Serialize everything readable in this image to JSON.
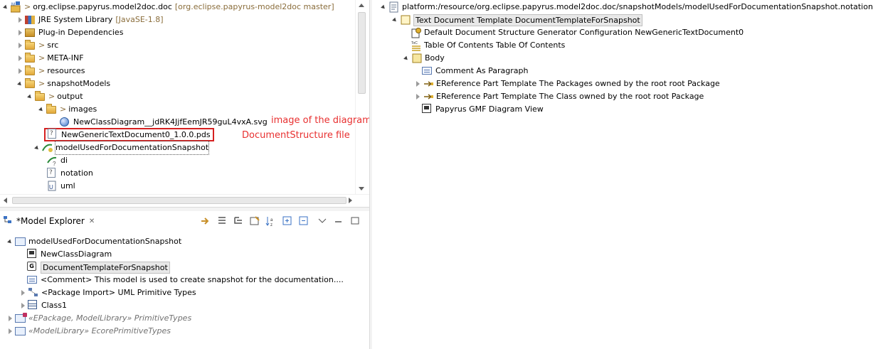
{
  "project_tree": {
    "root": {
      "label": "org.eclipse.papyrus.model2doc.doc",
      "suffix": "[org.eclipse.papyrus-model2doc master]"
    },
    "items": [
      {
        "label": "JRE System Library",
        "suffix": "[JavaSE-1.8]"
      },
      {
        "label": "Plug-in Dependencies"
      },
      {
        "label": "src"
      },
      {
        "label": "META-INF"
      },
      {
        "label": "resources"
      },
      {
        "label": "snapshotModels"
      },
      {
        "label": "output"
      },
      {
        "label": "images"
      },
      {
        "label": "NewClassDiagram__jdRK4JjfEemJR59guL4vxA.svg"
      },
      {
        "label": "NewGenericTextDocument0_1.0.0.pds"
      },
      {
        "label": "modelUsedForDocumentationSnapshot"
      },
      {
        "label": "di"
      },
      {
        "label": "notation"
      },
      {
        "label": "uml"
      }
    ],
    "decorator_prefix": ">"
  },
  "annotations": {
    "image_note": "image of the diagram",
    "pds_note": "DocumentStructure file"
  },
  "model_explorer": {
    "tab_title": "*Model Explorer",
    "tab_close": "✕",
    "items": [
      {
        "label": "modelUsedForDocumentationSnapshot"
      },
      {
        "label": "NewClassDiagram"
      },
      {
        "label": "DocumentTemplateForSnapshot"
      },
      {
        "label": "<Comment> This model is used to create snapshot for the documentation...."
      },
      {
        "label": "<Package Import> UML Primitive Types"
      },
      {
        "label": "Class1"
      },
      {
        "label": "«EPackage, ModelLibrary» PrimitiveTypes"
      },
      {
        "label": "«ModelLibrary» EcorePrimitiveTypes"
      }
    ]
  },
  "editor_tree": {
    "root": {
      "label": "platform:/resource/org.eclipse.papyrus.model2doc.doc/snapshotModels/modelUsedForDocumentationSnapshot.notation"
    },
    "items": [
      {
        "label": "Text Document Template DocumentTemplateForSnapshot"
      },
      {
        "label": "Default Document Structure Generator Configuration NewGenericTextDocument0"
      },
      {
        "label": "Table Of Contents Table Of Contents"
      },
      {
        "label": "Body"
      },
      {
        "label": "Comment As Paragraph"
      },
      {
        "label": "EReference Part Template The Packages owned by the root root Package"
      },
      {
        "label": "EReference Part Template The Class owned by the root root Package"
      },
      {
        "label": "Papyrus GMF Diagram View"
      }
    ]
  },
  "colors": {
    "annotation": "#e83030",
    "selection_border": "#d62020",
    "decoration": "#8a6d3b"
  }
}
